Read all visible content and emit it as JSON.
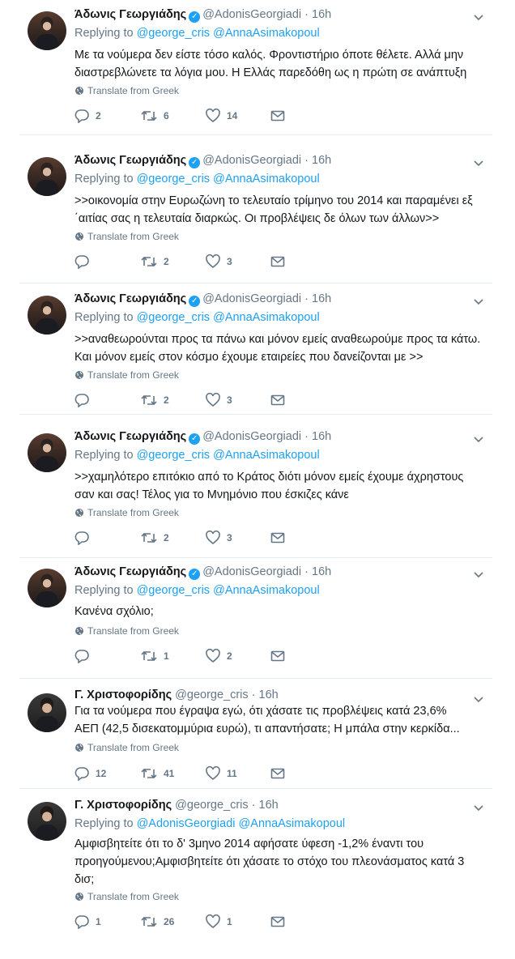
{
  "translate_label": "Translate from Greek",
  "replying_to_label": "Replying to",
  "accent_color": "#1da1f2",
  "tweets": [
    {
      "name": "Άδωνις Γεωργιάδης",
      "verified": true,
      "handle": "@AdonisGeorgiadi",
      "time": "16h",
      "reply_mentions": [
        "@george_cris",
        "@AnnaAsimakopoul"
      ],
      "text_lines": [
        "Με τα νούμερα δεν είστε τόσο καλός. Φροντιστήριο όποτε θέλετε. Αλλά μην",
        "διαστρεβλώνετε τα λόγια μου. Η Ελλάς παρεδόθη ως η πρώτη σε ανάπτυξη"
      ],
      "replies": "2",
      "retweets": "6",
      "likes": "14"
    },
    {
      "name": "Άδωνις Γεωργιάδης",
      "verified": true,
      "handle": "@AdonisGeorgiadi",
      "time": "16h",
      "reply_mentions": [
        "@george_cris",
        "@AnnaAsimakopoul"
      ],
      "text_lines": [
        ">>οικονομία στην Ευρωζώνη το τελευταίο τρίμηνο του 2014 και παραμένει εξ",
        "΄αιτίας σας η τελευταία διαρκώς. Οι προβλέψεις δε όλων των άλλων>>"
      ],
      "replies": "",
      "retweets": "2",
      "likes": "3"
    },
    {
      "name": "Άδωνις Γεωργιάδης",
      "verified": true,
      "handle": "@AdonisGeorgiadi",
      "time": "16h",
      "reply_mentions": [
        "@george_cris",
        "@AnnaAsimakopoul"
      ],
      "text_lines": [
        ">>αναθεωρούνται προς τα πάνω και μόνον εμείς αναθεωρούμε προς τα κάτω.",
        "Και μόνον εμείς στον κόσμο έχουμε εταιρείες που δανείζονται με >>"
      ],
      "replies": "",
      "retweets": "2",
      "likes": "3"
    },
    {
      "name": "Άδωνις Γεωργιάδης",
      "verified": true,
      "handle": "@AdonisGeorgiadi",
      "time": "16h",
      "reply_mentions": [
        "@george_cris",
        "@AnnaAsimakopoul"
      ],
      "text_lines": [
        ">>χαμηλότερο επιτόκιο από το Κράτος διότι μόνον εμείς έχουμε άχρηστους",
        "σαν και σας! Τέλος για το Μνημόνιο που έσκιζες κάνε"
      ],
      "replies": "",
      "retweets": "2",
      "likes": "3"
    },
    {
      "name": "Άδωνις Γεωργιάδης",
      "verified": true,
      "handle": "@AdonisGeorgiadi",
      "time": "16h",
      "reply_mentions": [
        "@george_cris",
        "@AnnaAsimakopoul"
      ],
      "text_lines": [
        "Κανένα σχόλιο;"
      ],
      "replies": "",
      "retweets": "1",
      "likes": "2"
    },
    {
      "name": "Γ. Χριστοφορίδης",
      "verified": false,
      "handle": "@george_cris",
      "time": "16h",
      "reply_mentions": [],
      "text_lines": [
        "Για τα νούμερα που έγραψα εγώ, ότι χάσατε τις προβλέψεις κατά 23,6%",
        "ΑΕΠ (42,5 δισεκατομμύρια ευρώ), τι απαντήσατε; Η μπάλα στην κερκίδα..."
      ],
      "replies": "12",
      "retweets": "41",
      "likes": "11"
    },
    {
      "name": "Γ. Χριστοφορίδης",
      "verified": false,
      "handle": "@george_cris",
      "time": "16h",
      "reply_mentions": [
        "@AdonisGeorgiadi",
        "@AnnaAsimakopoul"
      ],
      "text_lines": [
        "Αμφισβητείτε ότι το δ' 3μηνο 2014 αφήσατε ύφεση -1,2% έναντι του",
        "προηγούμενου;Αμφισβητείτε ότι χάσατε το στόχο του πλεονάσματος κατά 3",
        "δισ;"
      ],
      "replies": "1",
      "retweets": "26",
      "likes": "1"
    }
  ]
}
